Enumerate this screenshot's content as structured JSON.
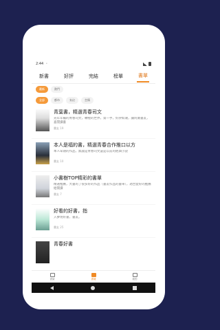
{
  "status": {
    "time": "2:44"
  },
  "tabs": [
    {
      "label": "新書",
      "active": false
    },
    {
      "label": "好評",
      "active": false
    },
    {
      "label": "完結",
      "active": false
    },
    {
      "label": "榜單",
      "active": false
    },
    {
      "label": "書單",
      "active": true
    }
  ],
  "filters": {
    "row1": [
      {
        "label": "最新",
        "active": true
      },
      {
        "label": "熱門",
        "active": false
      }
    ],
    "row2": [
      {
        "label": "全部",
        "active": true
      },
      {
        "label": "都市",
        "active": false
      },
      {
        "label": "玄幻",
        "active": false
      },
      {
        "label": "言情",
        "active": false
      }
    ]
  },
  "books": [
    {
      "title": "青葉書，精選青春司文",
      "desc": "光年年輪的青春司文，轉裡的世界，第一手，好評如潮，讓阿寶書友，喜閒讀書",
      "meta": "書友 19"
    },
    {
      "title": "本人是福的書，精選青春合作推口以方",
      "desc": "本人早期的作品，無論是青春司文還是以前的經典小說",
      "meta": "書友 10"
    },
    {
      "title": "小書樹TOP精彩的書單",
      "desc": "精選推薦，大書的了很多好的作品（書友作品的書單），適合愛好的推薦給閱讀",
      "meta": "書友 7"
    },
    {
      "title": "好看的好書，指",
      "desc": "入夢坊好書，書友。",
      "meta": "書友 25"
    },
    {
      "title": "青春好書",
      "desc": "",
      "meta": ""
    }
  ],
  "bottom_nav": [
    {
      "label": "書架",
      "icon": "bookshelf-icon",
      "active": false
    },
    {
      "label": "書城",
      "icon": "store-icon",
      "active": true
    },
    {
      "label": "我的",
      "icon": "profile-icon",
      "active": false
    }
  ]
}
